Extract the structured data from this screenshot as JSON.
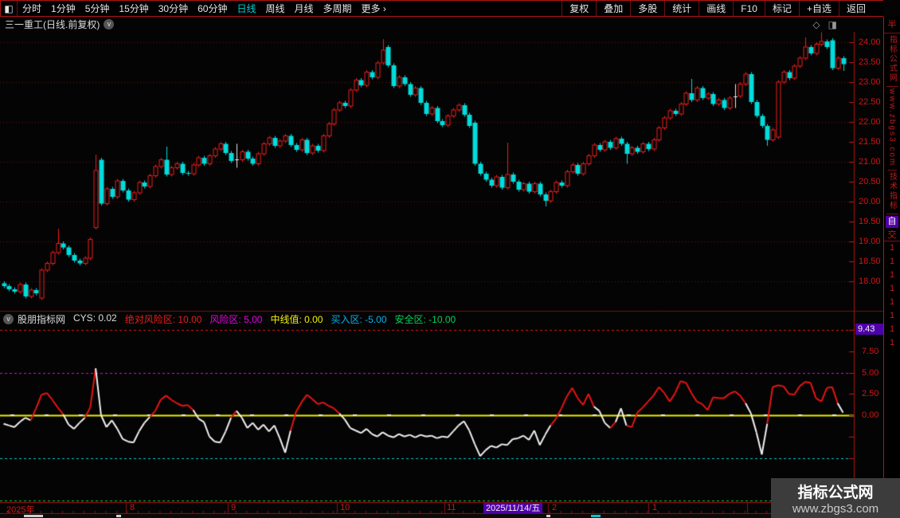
{
  "toolbar": {
    "window_icon": "◧",
    "left_items": [
      "分时",
      "1分钟",
      "5分钟",
      "15分钟",
      "30分钟",
      "60分钟",
      "日线",
      "周线",
      "月线",
      "多周期",
      "更多 ›"
    ],
    "active_item": "日线",
    "right_items": [
      "复权",
      "叠加",
      "多股",
      "统计",
      "画线",
      "F10",
      "标记",
      "+自选",
      "返回"
    ]
  },
  "title": {
    "stock": "三一重工(日线.前复权)",
    "chevron_icon": "v",
    "diamond_icon": "◇",
    "panel_icon": "◨"
  },
  "indicator_header": {
    "chevron_icon": "v",
    "fields": [
      {
        "label": "股朋指标网",
        "value": "",
        "color": "#dcdcdc"
      },
      {
        "label": "CYS:",
        "value": "0.02",
        "color": "#dcdcdc"
      },
      {
        "label": "绝对风险区:",
        "value": "10.00",
        "color": "#ee1c1c"
      },
      {
        "label": "风险区:",
        "value": "5.00",
        "color": "#e800e8"
      },
      {
        "label": "中线值:",
        "value": "0.00",
        "color": "#f0f000"
      },
      {
        "label": "买入区:",
        "value": "-5.00",
        "color": "#00b4f0"
      },
      {
        "label": "安全区:",
        "value": "-10.00",
        "color": "#00d25a"
      }
    ]
  },
  "watermark": {
    "line1": "指标公式网",
    "line2": "www.zbgs3.com"
  },
  "sidebar": {
    "top_label": "半",
    "sections": [
      {
        "text": "指标公式网"
      },
      {
        "text": "www.zbgs3.com"
      },
      {
        "text": "技术指标"
      }
    ],
    "highlight_label": "自",
    "sub_label": "交",
    "digits": [
      "1",
      "1",
      "1",
      "1",
      "1",
      "1",
      "1",
      "1"
    ]
  },
  "colors": {
    "up_candle": "#ee1c1c",
    "down_candle": "#00dcdc",
    "doji_highlight": "#e8e8e8",
    "axis_text": "#d41414",
    "grid": "#6e1212",
    "axis_line": "#aa1212",
    "curve_white": "#f0f0f0",
    "curve_red": "#e81414",
    "badge_purple": "#4e00a8",
    "active_tab": "#00d2d2"
  },
  "chart_data": {
    "type": "candlestick+line",
    "title": "三一重工 日线 前复权 + 股朋指标网 CYS 副图",
    "price_axis": {
      "ticks": [
        "24.00",
        "23.50",
        "23.00",
        "22.50",
        "22.00",
        "21.50",
        "21.00",
        "20.50",
        "20.00",
        "19.50",
        "19.00",
        "18.50",
        "18.00"
      ],
      "grid_prices": [
        24,
        23,
        22,
        21,
        20,
        19,
        18
      ],
      "ylim": [
        17.5,
        24.3
      ]
    },
    "candles": {
      "x_start": 4.5,
      "x_step": 6.8,
      "closes": [
        17.88,
        17.8,
        17.74,
        17.92,
        17.62,
        17.78,
        17.7,
        18.28,
        18.45,
        18.72,
        18.95,
        18.85,
        18.66,
        18.52,
        18.45,
        18.58,
        19.05,
        20.78,
        19.95,
        20.32,
        20.12,
        20.52,
        20.28,
        20.05,
        20.22,
        20.48,
        20.38,
        20.65,
        20.88,
        21.05,
        20.68,
        20.85,
        20.95,
        20.72,
        20.7,
        20.92,
        21.1,
        20.95,
        21.15,
        21.32,
        21.45,
        21.22,
        21.02,
        21.05,
        21.25,
        21.08,
        20.95,
        21.2,
        21.45,
        21.6,
        21.4,
        21.52,
        21.65,
        21.42,
        21.3,
        21.55,
        21.22,
        21.4,
        21.28,
        21.65,
        21.95,
        22.3,
        22.48,
        22.4,
        22.8,
        23.05,
        22.92,
        23.25,
        23.12,
        23.48,
        23.8,
        23.42,
        22.9,
        23.12,
        22.95,
        22.68,
        22.85,
        22.48,
        22.2,
        22.35,
        22.02,
        21.92,
        22.15,
        22.3,
        22.42,
        22.18,
        21.9,
        20.95,
        20.7,
        20.55,
        20.4,
        20.62,
        20.35,
        20.68,
        20.5,
        20.3,
        20.45,
        20.25,
        20.45,
        20.18,
        20.02,
        20.25,
        20.48,
        20.4,
        20.75,
        20.92,
        20.7,
        20.95,
        21.15,
        21.42,
        21.3,
        21.5,
        21.35,
        21.58,
        21.45,
        21.2,
        21.35,
        21.25,
        21.45,
        21.32,
        21.55,
        21.85,
        22.1,
        22.28,
        22.2,
        22.45,
        22.72,
        22.55,
        22.85,
        22.6,
        22.7,
        22.45,
        22.55,
        22.35,
        22.6,
        22.65,
        22.95,
        23.2,
        22.5,
        22.15,
        21.9,
        21.55,
        21.8,
        23.0,
        23.25,
        23.1,
        23.4,
        23.6,
        23.88,
        23.72,
        23.95,
        24.02,
        23.88,
        23.35,
        23.6,
        23.45
      ],
      "overrides": {
        "0": {
          "o": 17.95
        },
        "7": {
          "o": 17.58
        },
        "10": {
          "h": 19.32
        },
        "17": {
          "o": 19.35,
          "h": 21.18
        },
        "18": {
          "o": 21.05
        },
        "30": {
          "h": 21.38
        },
        "43": {
          "white": true,
          "h": 21.45,
          "l": 20.85
        },
        "70": {
          "h": 24.08
        },
        "71": {
          "o": 23.88
        },
        "87": {
          "o": 21.98
        },
        "93": {
          "h": 21.48
        },
        "100": {
          "l": 19.88
        },
        "115": {
          "l": 20.95
        },
        "127": {
          "h": 23.08
        },
        "135": {
          "white": true,
          "h": 22.95,
          "l": 22.35
        },
        "141": {
          "l": 21.4
        },
        "143": {
          "o": 21.62
        },
        "148": {
          "h": 24.12
        },
        "151": {
          "h": 24.25
        },
        "153": {
          "o": 24.05
        },
        "155": {
          "l": 23.28
        }
      }
    },
    "indicator": {
      "name": "CYS",
      "values": [
        -1.0,
        -1.2,
        -1.4,
        -0.8,
        -0.3,
        -0.6,
        0.8,
        2.4,
        2.6,
        1.8,
        0.9,
        0.1,
        -1.1,
        -1.6,
        -0.9,
        -0.3,
        0.9,
        5.5,
        0.0,
        -1.4,
        -0.6,
        -1.6,
        -2.8,
        -3.1,
        -3.2,
        -1.9,
        -0.9,
        -0.2,
        0.5,
        1.8,
        2.3,
        1.8,
        1.4,
        1.1,
        1.2,
        0.6,
        -0.4,
        -0.8,
        -2.5,
        -3.1,
        -3.2,
        -1.9,
        -0.3,
        0.5,
        -0.3,
        -1.5,
        -0.9,
        -1.7,
        -1.1,
        -1.9,
        -1.2,
        -2.7,
        -4.4,
        -1.8,
        0.4,
        1.5,
        2.4,
        1.9,
        1.3,
        1.5,
        1.1,
        0.8,
        0.2,
        -0.5,
        -1.5,
        -1.8,
        -2.1,
        -1.6,
        -2.2,
        -2.5,
        -2.0,
        -2.4,
        -2.6,
        -2.2,
        -2.5,
        -2.3,
        -2.6,
        -2.3,
        -2.5,
        -2.4,
        -2.7,
        -2.5,
        -2.6,
        -1.9,
        -1.2,
        -0.7,
        -1.8,
        -3.4,
        -4.8,
        -4.1,
        -3.6,
        -3.8,
        -3.4,
        -3.5,
        -2.8,
        -2.7,
        -2.4,
        -2.9,
        -1.8,
        -3.5,
        -2.3,
        -1.2,
        -0.4,
        0.8,
        2.2,
        3.2,
        2.0,
        1.2,
        2.5,
        1.0,
        0.5,
        -0.9,
        -1.5,
        -0.8,
        0.8,
        -1.2,
        -1.4,
        0.3,
        0.9,
        1.6,
        2.3,
        3.3,
        2.6,
        1.6,
        2.6,
        4.0,
        3.8,
        2.6,
        1.6,
        1.3,
        0.6,
        2.1,
        2.0,
        2.0,
        2.5,
        2.8,
        2.3,
        1.4,
        0.2,
        -2.0,
        -4.6,
        -1.0,
        3.3,
        3.5,
        3.4,
        2.5,
        2.4,
        3.4,
        3.9,
        3.8,
        2.0,
        1.6,
        3.2,
        3.3,
        1.4,
        0.3
      ],
      "colors": "wwwwwwrrrrrrwwwwrrwwwwwwwwwwrrrrrrrrwwwwwwwrwwwwwwwwwwrrrrrrrrrwwwwwwwwwwwwwwwwwwwwwwwwwwwwwwwwwwwwwwwrrrrrrrrwwwrwwrrrrrrrrrrrrrrrrrrrrrrwwwwrrrrrrrrrrrrr",
      "levels": [
        {
          "value": 10,
          "color": "#e01414",
          "style": "dashed"
        },
        {
          "value": 5,
          "color": "#e800e8",
          "style": "dashed"
        },
        {
          "value": 0,
          "color": "#f0f000",
          "style": "solid"
        },
        {
          "value": -5,
          "color": "#00c8c8",
          "style": "dashed"
        },
        {
          "value": -10,
          "color": "#00cc3c",
          "style": "dashed"
        }
      ],
      "axis_ticks": [
        "7.50",
        "5.00",
        "2.50",
        "0.00"
      ],
      "badge": "9.43"
    },
    "x_axis": {
      "year_label": "2025年",
      "year_x": 8,
      "months": [
        {
          "label": "8",
          "x": 163
        },
        {
          "label": "9",
          "x": 290
        },
        {
          "label": "10",
          "x": 427
        },
        {
          "label": "11",
          "x": 561
        },
        {
          "label": "2",
          "x": 693
        },
        {
          "label": "1",
          "x": 819
        }
      ],
      "boundaries": [
        158,
        286,
        423,
        558,
        688,
        814,
        938
      ],
      "date_badge": "2025/11/14/五",
      "date_badge_x": 607
    }
  }
}
